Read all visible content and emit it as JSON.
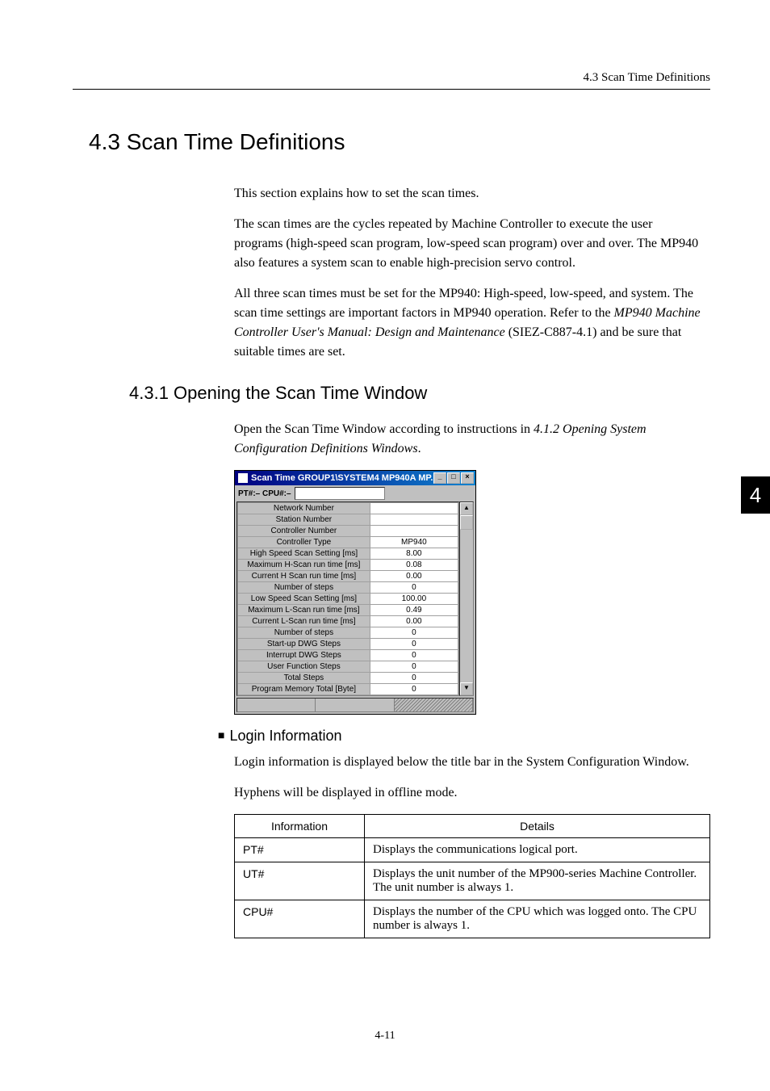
{
  "header": {
    "right": "4.3  Scan Time Definitions"
  },
  "section": {
    "title": "4.3  Scan Time Definitions",
    "p1": "This section explains how to set the scan times.",
    "p2": "The scan times are the cycles repeated by Machine Controller to execute the user programs (high-speed scan program, low-speed scan program) over and over. The MP940 also features a system scan to enable high-precision servo control.",
    "p3a": "All three scan times must be set for the MP940: High-speed, low-speed, and system. The scan time settings are important factors in MP940 operation. Refer to the ",
    "p3i": "MP940 Machine Controller User's Manual: Design and Maintenance",
    "p3b": " (SIEZ-C887-4.1) and be sure that suitable times are set."
  },
  "sub1": {
    "title": "4.3.1  Opening the Scan Time Window",
    "p1a": "Open the Scan Time Window according to instructions in ",
    "p1i": "4.1.2 Opening System Configuration Definitions Windows",
    "p1b": "."
  },
  "tab": "4",
  "win": {
    "title": "Scan Time    GROUP1\\SYSTEM4  MP940A  MP...",
    "sub": "PT#:– CPU#:–",
    "rows": [
      {
        "label": "Network Number",
        "val": ""
      },
      {
        "label": "Station Number",
        "val": ""
      },
      {
        "label": "Controller Number",
        "val": ""
      },
      {
        "label": "Controller Type",
        "val": "MP940"
      },
      {
        "label": "High Speed Scan Setting [ms]",
        "val": "8.00"
      },
      {
        "label": "Maximum H-Scan run time [ms]",
        "val": "0.08"
      },
      {
        "label": "Current H Scan run time [ms]",
        "val": "0.00"
      },
      {
        "label": "Number of steps",
        "val": "0"
      },
      {
        "label": "Low Speed Scan Setting [ms]",
        "val": "100.00"
      },
      {
        "label": "Maximum L-Scan run time [ms]",
        "val": "0.49"
      },
      {
        "label": "Current L-Scan run time [ms]",
        "val": "0.00"
      },
      {
        "label": "Number of steps",
        "val": "0"
      },
      {
        "label": "Start-up DWG    Steps",
        "val": "0"
      },
      {
        "label": "Interrupt DWG    Steps",
        "val": "0"
      },
      {
        "label": "User Function   Steps",
        "val": "0"
      },
      {
        "label": "Total Steps",
        "val": "0"
      },
      {
        "label": "Program Memory Total      [Byte]",
        "val": "0"
      }
    ]
  },
  "login": {
    "heading": "Login Information",
    "p1": "Login information is displayed below the title bar in the System Configuration Window.",
    "p2": "Hyphens will be displayed in offline mode.",
    "th1": "Information",
    "th2": "Details",
    "rows": [
      {
        "k": "PT#",
        "v": "Displays the communications logical port."
      },
      {
        "k": "UT#",
        "v": "Displays the unit number of the MP900-series Machine Controller. The unit number is always 1."
      },
      {
        "k": "CPU#",
        "v": "Displays the number of the CPU which was logged onto. The CPU number is always 1."
      }
    ]
  },
  "footer": "4-11"
}
